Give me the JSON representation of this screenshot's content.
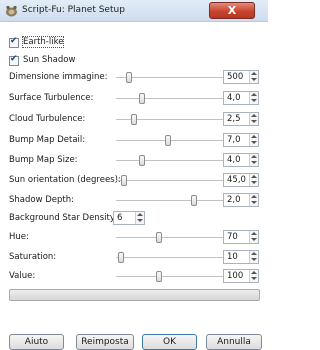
{
  "window": {
    "title": "Script-Fu: Planet Setup",
    "close_label": "X"
  },
  "checkboxes": [
    {
      "label": "Earth-like",
      "checked": true
    },
    {
      "label": "Sun Shadow",
      "checked": true
    }
  ],
  "params": [
    {
      "label": "Dimensione immagine:",
      "value": "500",
      "level": 0.1
    },
    {
      "label": "Surface Turbulence:",
      "value": "4,0",
      "level": 0.22
    },
    {
      "label": "Cloud Turbulence:",
      "value": "2,5",
      "level": 0.14
    },
    {
      "label": "Bump Map Detail:",
      "value": "7,0",
      "level": 0.47
    },
    {
      "label": "Bump Map Size:",
      "value": "4,0",
      "level": 0.22
    },
    {
      "label": "Sun orientation (degrees):",
      "value": "45,0",
      "level": 0.05
    },
    {
      "label": "Shadow Depth:",
      "value": "2,0",
      "level": 0.72
    },
    {
      "label": "Background Star Density:",
      "value": "6"
    },
    {
      "label": "Hue:",
      "value": "70",
      "level": 0.38
    },
    {
      "label": "Saturation:",
      "value": "10",
      "level": 0.02
    },
    {
      "label": "Value:",
      "value": "100",
      "level": 0.38
    }
  ],
  "buttons": {
    "help": "Aiuto",
    "reset": "Reimposta",
    "ok": "OK",
    "cancel": "Annulla"
  }
}
